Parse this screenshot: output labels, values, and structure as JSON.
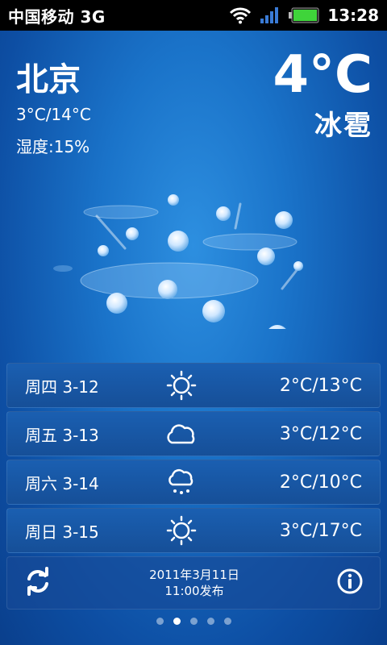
{
  "status_bar": {
    "carrier": "中国移动 3G",
    "time": "13:28"
  },
  "current": {
    "city": "北京",
    "range": "3°C/14°C",
    "humidity": "湿度:15%",
    "temp": "4°C",
    "condition": "冰雹"
  },
  "forecast": [
    {
      "day": "周四 3-12",
      "icon": "sun-icon",
      "range": "2°C/13°C"
    },
    {
      "day": "周五 3-13",
      "icon": "cloud-icon",
      "range": "3°C/12°C"
    },
    {
      "day": "周六 3-14",
      "icon": "rain-cloud-icon",
      "range": "2°C/10°C"
    },
    {
      "day": "周日 3-15",
      "icon": "sun-icon",
      "range": "3°C/17°C"
    }
  ],
  "footer": {
    "publish_date": "2011年3月11日",
    "publish_time": "11:00发布"
  },
  "pager": {
    "count": 5,
    "active": 1
  },
  "colors": {
    "accent_bg": "#1a73c9",
    "battery": "#3fd43a"
  }
}
